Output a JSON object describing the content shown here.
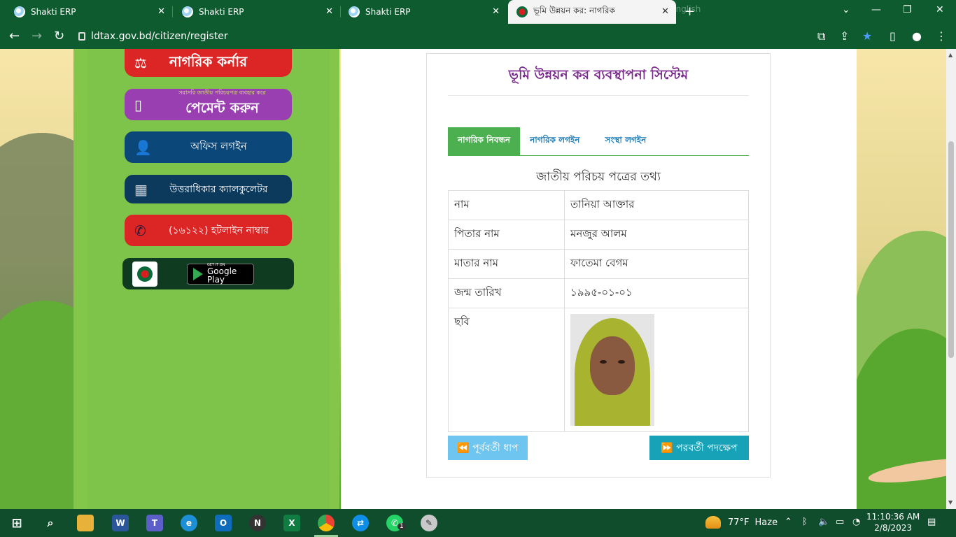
{
  "browser": {
    "tabs": [
      {
        "title": "Shakti ERP",
        "active": false
      },
      {
        "title": "Shakti ERP",
        "active": false
      },
      {
        "title": "Shakti ERP",
        "active": false
      },
      {
        "title": "ভূমি উন্নয়ন কর: নাগরিক",
        "active": true
      }
    ],
    "extension_hint": "English",
    "url": "ldtax.gov.bd/citizen/register"
  },
  "sidebar": {
    "citizen_corner": "নাগরিক কর্নার",
    "payment_small": "সরাসরি জাতীয় পরিচয়পত্র ব্যবহার করে",
    "payment_big": "পেমেন্ট করুন",
    "office_login": "অফিস লগইন",
    "calculator": "উত্তরাধিকার ক্যালকুলেটর",
    "hotline": "(১৬১২২) হটলাইন নাম্বার",
    "gplay_small": "GET IT ON",
    "gplay_big": "Google Play"
  },
  "card": {
    "title": "ভূমি উন্নয়ন কর ব্যবস্থাপনা সিস্টেম",
    "tabs": {
      "register": "নাগরিক নিবন্ধন",
      "citizen_login": "নাগরিক লগইন",
      "org_login": "সংস্থা লগইন"
    },
    "section_title": "জাতীয় পরিচয় পত্রের তথ্য",
    "rows": {
      "name_label": "নাম",
      "name_value": "তানিয়া আক্তার",
      "father_label": "পিতার নাম",
      "father_value": "মনজুর আলম",
      "mother_label": "মাতার নাম",
      "mother_value": "ফাতেমা বেগম",
      "dob_label": "জন্ম তারিখ",
      "dob_value": "১৯৯৫-০১-০১",
      "photo_label": "ছবি"
    },
    "prev_button": "⏪ পূর্ববর্তী ধাপ",
    "next_button": "⏩ পরবর্তী পদক্ষেপ"
  },
  "taskbar": {
    "weather_temp": "77°F",
    "weather_desc": "Haze",
    "time": "11:10:36 AM",
    "date": "2/8/2023",
    "whatsapp_badge": "1"
  },
  "colors": {
    "chrome_green": "#0d5b2f",
    "card_title": "#7b2a8d",
    "tab_active": "#4caf50",
    "tab_link": "#1d7bb5",
    "next_button": "#17a2b8",
    "prev_button": "#6ec6f0"
  }
}
